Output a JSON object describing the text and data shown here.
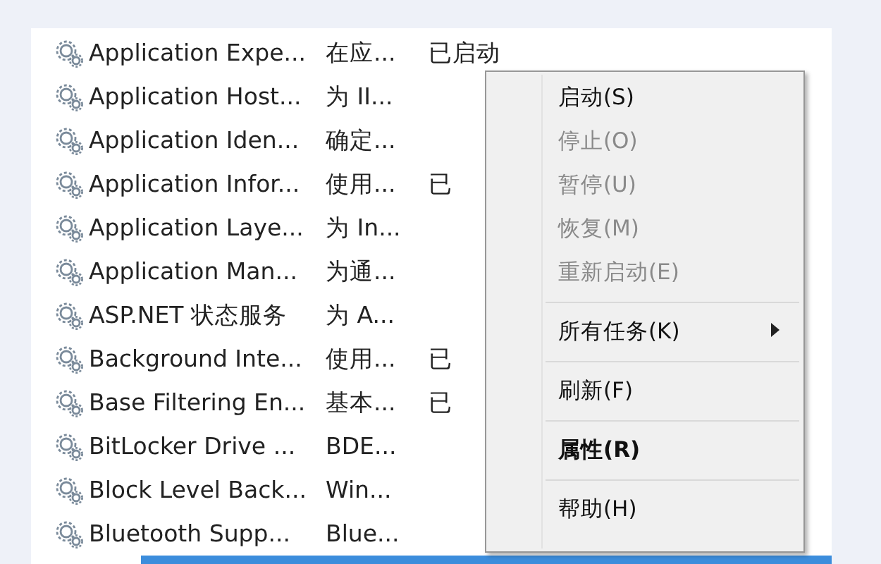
{
  "services": [
    {
      "name": "Application Expe...",
      "description": "在应...",
      "status": "已启动",
      "selected": false
    },
    {
      "name": "Application Host...",
      "description": "为 II...",
      "selected": false
    },
    {
      "name": "Application Iden...",
      "description": "确定...",
      "selected": false
    },
    {
      "name": "Application Infor...",
      "description": "使用...",
      "status": "已",
      "selected": false
    },
    {
      "name": "Application Laye...",
      "description": "为 In...",
      "selected": false
    },
    {
      "name": "Application Man...",
      "description": "为通...",
      "selected": false
    },
    {
      "name": "ASP.NET 状态服务",
      "description": "为 A...",
      "selected": false
    },
    {
      "name": "Background Inte...",
      "description": "使用...",
      "status": "已",
      "selected": false
    },
    {
      "name": "Base Filtering En...",
      "description": "基本...",
      "status": "已",
      "selected": false
    },
    {
      "name": "BitLocker Drive ...",
      "description": "BDE...",
      "selected": false
    },
    {
      "name": "Block Level Back...",
      "description": "Win...",
      "selected": false
    },
    {
      "name": "Bluetooth Supp...",
      "description": "Blue...",
      "selected": false
    },
    {
      "selected": true
    }
  ],
  "context_menu": [
    {
      "kind": "item",
      "label": "启动(S)",
      "disabled": false,
      "default": false,
      "submenu": false
    },
    {
      "kind": "item",
      "label": "停止(O)",
      "disabled": true,
      "default": false,
      "submenu": false
    },
    {
      "kind": "item",
      "label": "暂停(U)",
      "disabled": true,
      "default": false,
      "submenu": false
    },
    {
      "kind": "item",
      "label": "恢复(M)",
      "disabled": true,
      "default": false,
      "submenu": false
    },
    {
      "kind": "item",
      "label": "重新启动(E)",
      "disabled": true,
      "default": false,
      "submenu": false
    },
    {
      "kind": "separator"
    },
    {
      "kind": "item",
      "label": "所有任务(K)",
      "disabled": false,
      "default": false,
      "submenu": true
    },
    {
      "kind": "separator"
    },
    {
      "kind": "item",
      "label": "刷新(F)",
      "disabled": false,
      "default": false,
      "submenu": false
    },
    {
      "kind": "separator"
    },
    {
      "kind": "item",
      "label": "属性(R)",
      "disabled": false,
      "default": true,
      "submenu": false
    },
    {
      "kind": "separator"
    },
    {
      "kind": "item",
      "label": "帮助(H)",
      "disabled": false,
      "default": false,
      "submenu": false
    }
  ]
}
